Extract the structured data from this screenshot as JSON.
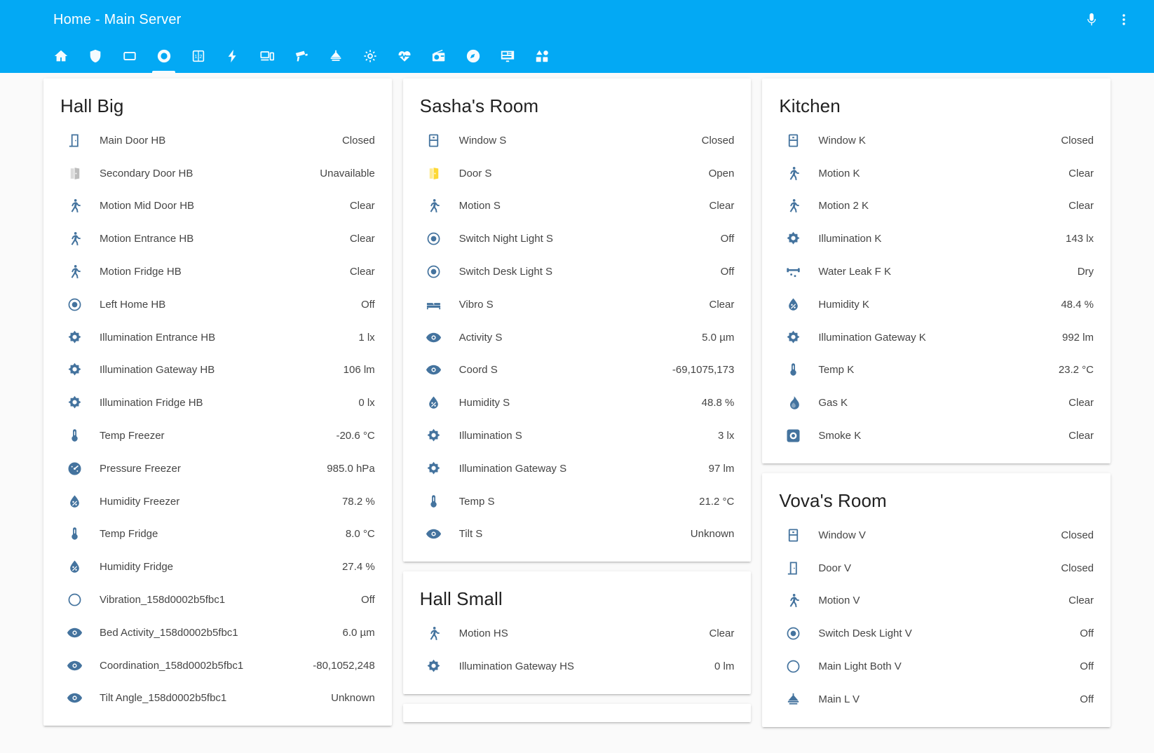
{
  "appbar": {
    "title": "Home - Main Server",
    "actions": [
      {
        "name": "voice-assistant-icon",
        "label": "Assist"
      },
      {
        "name": "overflow-menu-icon",
        "label": "Menu"
      }
    ]
  },
  "tabs": [
    {
      "icon": "home-icon",
      "label": "Home",
      "active": false
    },
    {
      "icon": "shield-icon",
      "label": "Security",
      "active": false
    },
    {
      "icon": "window-icon",
      "label": "Openings",
      "active": false
    },
    {
      "icon": "eye-circle-icon",
      "label": "Sensors",
      "active": true
    },
    {
      "icon": "counter-icon",
      "label": "Counters",
      "active": false
    },
    {
      "icon": "lightning-icon",
      "label": "Energy",
      "active": false
    },
    {
      "icon": "devices-icon",
      "label": "Devices",
      "active": false
    },
    {
      "icon": "cctv-icon",
      "label": "Cameras",
      "active": false
    },
    {
      "icon": "ceiling-light-icon",
      "label": "Lights",
      "active": false
    },
    {
      "icon": "gear-icon",
      "label": "Settings",
      "active": false
    },
    {
      "icon": "heart-pulse-icon",
      "label": "Health",
      "active": false
    },
    {
      "icon": "radio-icon",
      "label": "Media",
      "active": false
    },
    {
      "icon": "compass-icon",
      "label": "Location",
      "active": false
    },
    {
      "icon": "monitor-icon",
      "label": "System",
      "active": false
    },
    {
      "icon": "shapes-icon",
      "label": "More",
      "active": false
    }
  ],
  "columns": [
    {
      "cards": [
        {
          "title": "Hall Big",
          "rows": [
            {
              "icon": "door-closed-icon",
              "name": "Main Door HB",
              "state": "Closed"
            },
            {
              "icon": "door-open-icon",
              "name": "Secondary Door HB",
              "state": "Unavailable",
              "icon_style": "unavailable"
            },
            {
              "icon": "motion-icon",
              "name": "Motion Mid Door HB",
              "state": "Clear"
            },
            {
              "icon": "motion-icon",
              "name": "Motion Entrance HB",
              "state": "Clear"
            },
            {
              "icon": "motion-icon",
              "name": "Motion Fridge HB",
              "state": "Clear"
            },
            {
              "icon": "radio-button-icon",
              "name": "Left Home HB",
              "state": "Off"
            },
            {
              "icon": "brightness-icon",
              "name": "Illumination Entrance HB",
              "state": "1 lx"
            },
            {
              "icon": "brightness-icon",
              "name": "Illumination Gateway HB",
              "state": "106 lm"
            },
            {
              "icon": "brightness-icon",
              "name": "Illumination Fridge HB",
              "state": "0 lx"
            },
            {
              "icon": "thermometer-icon",
              "name": "Temp Freezer",
              "state": "-20.6 °C"
            },
            {
              "icon": "gauge-icon",
              "name": "Pressure Freezer",
              "state": "985.0 hPa"
            },
            {
              "icon": "humidity-icon",
              "name": "Humidity Freezer",
              "state": "78.2 %"
            },
            {
              "icon": "thermometer-icon",
              "name": "Temp Fridge",
              "state": "8.0 °C"
            },
            {
              "icon": "humidity-icon",
              "name": "Humidity Fridge",
              "state": "27.4 %"
            },
            {
              "icon": "circle-outline-icon",
              "name": "Vibration_158d0002b5fbc1",
              "state": "Off"
            },
            {
              "icon": "eye-icon",
              "name": "Bed Activity_158d0002b5fbc1",
              "state": "6.0 µm"
            },
            {
              "icon": "eye-icon",
              "name": "Coordination_158d0002b5fbc1",
              "state": "-80,1052,248"
            },
            {
              "icon": "eye-icon",
              "name": "Tilt Angle_158d0002b5fbc1",
              "state": "Unknown"
            }
          ]
        }
      ]
    },
    {
      "cards": [
        {
          "title": "Sasha's Room",
          "rows": [
            {
              "icon": "window-closed-icon",
              "name": "Window S",
              "state": "Closed"
            },
            {
              "icon": "door-open-icon",
              "name": "Door S",
              "state": "Open",
              "icon_style": "amber"
            },
            {
              "icon": "motion-icon",
              "name": "Motion S",
              "state": "Clear"
            },
            {
              "icon": "radio-button-icon",
              "name": "Switch Night Light S",
              "state": "Off"
            },
            {
              "icon": "radio-button-icon",
              "name": "Switch Desk Light S",
              "state": "Off"
            },
            {
              "icon": "bed-icon",
              "name": "Vibro S",
              "state": "Clear"
            },
            {
              "icon": "eye-icon",
              "name": "Activity S",
              "state": "5.0 µm"
            },
            {
              "icon": "eye-icon",
              "name": "Coord S",
              "state": "-69,1075,173"
            },
            {
              "icon": "humidity-icon",
              "name": "Humidity S",
              "state": "48.8 %"
            },
            {
              "icon": "brightness-icon",
              "name": "Illumination S",
              "state": "3 lx"
            },
            {
              "icon": "brightness-icon",
              "name": "Illumination Gateway S",
              "state": "97 lm"
            },
            {
              "icon": "thermometer-icon",
              "name": "Temp S",
              "state": "21.2 °C"
            },
            {
              "icon": "eye-icon",
              "name": "Tilt S",
              "state": "Unknown"
            }
          ]
        },
        {
          "title": "Hall Small",
          "rows": [
            {
              "icon": "motion-icon",
              "name": "Motion HS",
              "state": "Clear"
            },
            {
              "icon": "brightness-icon",
              "name": "Illumination Gateway HS",
              "state": "0 lm"
            }
          ]
        }
      ]
    },
    {
      "cards": [
        {
          "title": "Kitchen",
          "rows": [
            {
              "icon": "window-closed-icon",
              "name": "Window K",
              "state": "Closed"
            },
            {
              "icon": "motion-icon",
              "name": "Motion K",
              "state": "Clear"
            },
            {
              "icon": "motion-icon",
              "name": "Motion 2 K",
              "state": "Clear"
            },
            {
              "icon": "brightness-icon",
              "name": "Illumination K",
              "state": "143 lx"
            },
            {
              "icon": "water-leak-icon",
              "name": "Water Leak F K",
              "state": "Dry"
            },
            {
              "icon": "humidity-icon",
              "name": "Humidity K",
              "state": "48.4 %"
            },
            {
              "icon": "brightness-icon",
              "name": "Illumination Gateway K",
              "state": "992 lm"
            },
            {
              "icon": "thermometer-icon",
              "name": "Temp K",
              "state": "23.2 °C"
            },
            {
              "icon": "flame-icon",
              "name": "Gas K",
              "state": "Clear"
            },
            {
              "icon": "smoke-icon",
              "name": "Smoke K",
              "state": "Clear"
            }
          ]
        },
        {
          "title": "Vova's Room",
          "rows": [
            {
              "icon": "window-closed-icon",
              "name": "Window V",
              "state": "Closed"
            },
            {
              "icon": "door-closed-icon",
              "name": "Door V",
              "state": "Closed"
            },
            {
              "icon": "motion-icon",
              "name": "Motion V",
              "state": "Clear"
            },
            {
              "icon": "radio-button-icon",
              "name": "Switch Desk Light V",
              "state": "Off"
            },
            {
              "icon": "circle-outline-icon",
              "name": "Main Light Both V",
              "state": "Off"
            },
            {
              "icon": "ceiling-light-icon",
              "name": "Main L V",
              "state": "Off"
            }
          ]
        }
      ]
    }
  ],
  "colors": {
    "accent": "#03a9f4",
    "icon": "#44739e",
    "amber": "#fdd835",
    "unavailable": "#bdbdbd",
    "text": "#454545"
  }
}
